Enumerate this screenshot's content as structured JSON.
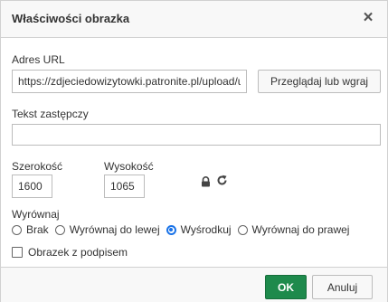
{
  "dialog": {
    "title": "Właściwości obrazka",
    "close_icon": "close-icon"
  },
  "url": {
    "label": "Adres URL",
    "value": "https://zdjeciedowizytowki.patronite.pl/upload/u",
    "browse_label": "Przeglądaj lub wgraj"
  },
  "alt": {
    "label": "Tekst zastępczy",
    "value": ""
  },
  "size": {
    "width_label": "Szerokość",
    "width_value": "1600",
    "height_label": "Wysokość",
    "height_value": "1065",
    "lock_icon": "lock-icon",
    "reset_icon": "reset-icon"
  },
  "alignment": {
    "label": "Wyrównaj",
    "options": [
      "Brak",
      "Wyrównaj do lewej",
      "Wyśrodkuj",
      "Wyrównaj do prawej"
    ],
    "selected": "Wyśrodkuj"
  },
  "caption": {
    "label": "Obrazek z podpisem",
    "checked": false
  },
  "footer": {
    "ok_label": "OK",
    "cancel_label": "Anuluj"
  },
  "colors": {
    "ok_button": "#1e8a4c",
    "radio_accent": "#1a73e8"
  }
}
